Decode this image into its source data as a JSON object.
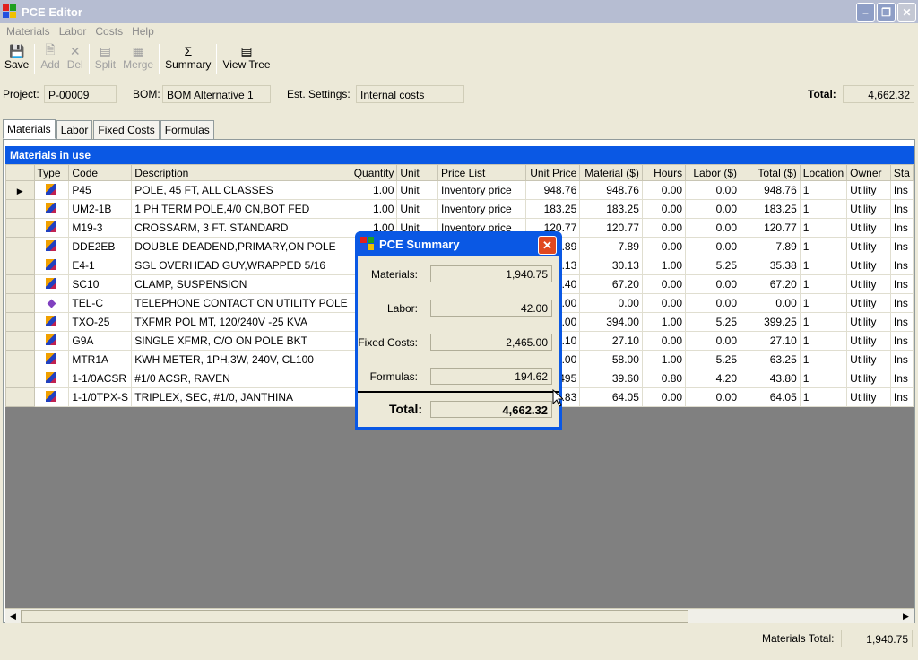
{
  "window": {
    "title": "PCE Editor"
  },
  "menu": [
    "Materials",
    "Labor",
    "Costs",
    "Help"
  ],
  "toolbar": [
    {
      "label": "Save",
      "icon": "save-icon",
      "enabled": true
    },
    {
      "label": "Add",
      "icon": "add-icon",
      "enabled": false
    },
    {
      "label": "Del",
      "icon": "delete-icon",
      "enabled": false
    },
    {
      "label": "Split",
      "icon": "split-icon",
      "enabled": false
    },
    {
      "label": "Merge",
      "icon": "merge-icon",
      "enabled": false
    },
    {
      "label": "Summary",
      "icon": "sigma-icon",
      "enabled": true
    },
    {
      "label": "View Tree",
      "icon": "tree-icon",
      "enabled": true
    }
  ],
  "project": {
    "project_label": "Project:",
    "project_value": "P-00009",
    "bom_label": "BOM:",
    "bom_value": "BOM Alternative 1",
    "est_label": "Est. Settings:",
    "est_value": "Internal costs",
    "total_label": "Total:",
    "total_value": "4,662.32"
  },
  "tabs": [
    "Materials",
    "Labor",
    "Fixed Costs",
    "Formulas"
  ],
  "grid": {
    "caption": "Materials in use",
    "columns": [
      "Type",
      "Code",
      "Description",
      "Quantity",
      "Unit",
      "Price List",
      "Unit Price",
      "Material ($)",
      "Hours",
      "Labor ($)",
      "Total ($)",
      "Location",
      "Owner",
      "Sta"
    ],
    "rows": [
      [
        "P45",
        "POLE, 45 FT, ALL CLASSES",
        "1.00",
        "Unit",
        "Inventory price",
        "948.76",
        "948.76",
        "0.00",
        "0.00",
        "948.76",
        "1",
        "Utility",
        "Ins"
      ],
      [
        "UM2-1B",
        "1 PH TERM POLE,4/0 CN,BOT FED",
        "1.00",
        "Unit",
        "Inventory price",
        "183.25",
        "183.25",
        "0.00",
        "0.00",
        "183.25",
        "1",
        "Utility",
        "Ins"
      ],
      [
        "M19-3",
        "CROSSARM, 3 FT. STANDARD",
        "1.00",
        "Unit",
        "Inventory price",
        "120.77",
        "120.77",
        "0.00",
        "0.00",
        "120.77",
        "1",
        "Utility",
        "Ins"
      ],
      [
        "DDE2EB",
        "DOUBLE DEADEND,PRIMARY,ON POLE",
        "",
        "",
        "",
        "7.89",
        "7.89",
        "0.00",
        "0.00",
        "7.89",
        "1",
        "Utility",
        "Ins"
      ],
      [
        "E4-1",
        "SGL OVERHEAD GUY,WRAPPED 5/16",
        "",
        "",
        "",
        "0.13",
        "30.13",
        "1.00",
        "5.25",
        "35.38",
        "1",
        "Utility",
        "Ins"
      ],
      [
        "SC10",
        "CLAMP, SUSPENSION",
        "",
        "",
        "",
        "2.40",
        "67.20",
        "0.00",
        "0.00",
        "67.20",
        "1",
        "Utility",
        "Ins"
      ],
      [
        "TEL-C",
        "TELEPHONE CONTACT ON UTILITY POLE",
        "",
        "",
        "",
        "0.00",
        "0.00",
        "0.00",
        "0.00",
        "0.00",
        "1",
        "Utility",
        "Ins"
      ],
      [
        "TXO-25",
        "TXFMR POL MT, 120/240V -25 KVA",
        "",
        "",
        "",
        "4.00",
        "394.00",
        "1.00",
        "5.25",
        "399.25",
        "1",
        "Utility",
        "Ins"
      ],
      [
        "G9A",
        "SINGLE XFMR, C/O ON POLE BKT",
        "",
        "",
        "",
        "7.10",
        "27.10",
        "0.00",
        "0.00",
        "27.10",
        "1",
        "Utility",
        "Ins"
      ],
      [
        "MTR1A",
        "KWH METER, 1PH,3W, 240V, CL100",
        "",
        "",
        "",
        "3.00",
        "58.00",
        "1.00",
        "5.25",
        "63.25",
        "1",
        "Utility",
        "Ins"
      ],
      [
        "1-1/0ACSR",
        "#1/0 ACSR, RAVEN",
        "",
        "",
        "",
        ".495",
        "39.60",
        "0.80",
        "4.20",
        "43.80",
        "1",
        "Utility",
        "Ins"
      ],
      [
        "1-1/0TPX-S",
        "TRIPLEX, SEC, #1/0, JANTHINA",
        "",
        "",
        "",
        "1.83",
        "64.05",
        "0.00",
        "0.00",
        "64.05",
        "1",
        "Utility",
        "Ins"
      ]
    ],
    "row_icons": [
      "tool-icon",
      "tool-icon",
      "tool-icon",
      "tool-icon",
      "tool-icon",
      "tool-icon",
      "diamond-icon",
      "tool-icon",
      "tool-icon",
      "tool-icon",
      "tool-icon",
      "tool-icon"
    ]
  },
  "footer": {
    "label": "Materials Total:",
    "value": "1,940.75"
  },
  "summary": {
    "title": "PCE Summary",
    "materials_label": "Materials:",
    "materials_value": "1,940.75",
    "labor_label": "Labor:",
    "labor_value": "42.00",
    "fixed_label": "Fixed Costs:",
    "fixed_value": "2,465.00",
    "formulas_label": "Formulas:",
    "formulas_value": "194.62",
    "total_label": "Total:",
    "total_value": "4,662.32"
  },
  "colors": {
    "titlebar": "#b6bdd2",
    "caption": "#0a58e4",
    "dialog": "#0a58e4",
    "close": "#e04820"
  }
}
